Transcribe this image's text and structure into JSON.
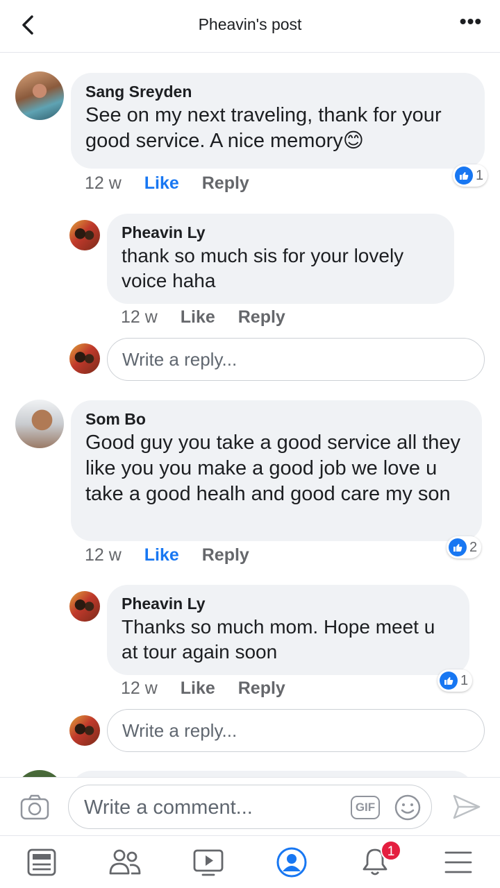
{
  "header": {
    "title": "Pheavin's post"
  },
  "comments": [
    {
      "author": "Sang Sreyden",
      "text": "See on my next traveling, thank for your good service. A nice memory😊",
      "time": "12 w",
      "like_label": "Like",
      "reply_label": "Reply",
      "like_count": "1",
      "like_active": true,
      "reply": {
        "author": "Pheavin Ly",
        "text": "thank so much sis for your lovely voice haha",
        "time": "12 w",
        "like_label": "Like",
        "reply_label": "Reply"
      },
      "reply_placeholder": "Write a reply..."
    },
    {
      "author": "Som Bo",
      "text": "Good guy you take a good service all they like you you make a good job we love u take a good healh and good care my son",
      "time": "12 w",
      "like_label": "Like",
      "reply_label": "Reply",
      "like_count": "2",
      "like_active": true,
      "reply": {
        "author": "Pheavin Ly",
        "text": "Thanks so much mom. Hope meet u at tour again soon",
        "time": "12 w",
        "like_label": "Like",
        "reply_label": "Reply",
        "like_count": "1"
      },
      "reply_placeholder": "Write a reply..."
    }
  ],
  "composer": {
    "placeholder": "Write a comment...",
    "gif_label": "GIF"
  },
  "nav": {
    "notifications_count": "1"
  },
  "colors": {
    "accent": "#1877f2",
    "bubble": "#f0f2f5",
    "badge": "#e41e3f"
  }
}
